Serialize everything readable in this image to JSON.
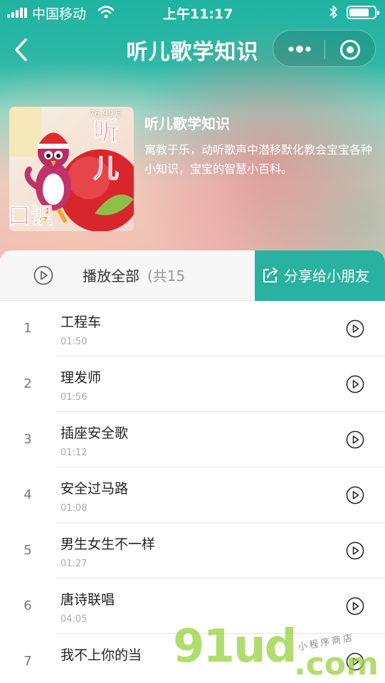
{
  "status_bar": {
    "carrier": "中国移动",
    "time": "上午11:17",
    "battery_level": 0.8
  },
  "nav": {
    "title": "听儿歌学知识"
  },
  "album": {
    "cover_text_top": "听儿",
    "cover_text_bottom": "口识",
    "plays": "76.99万",
    "title": "听儿歌学知识",
    "description": "寓教于乐，动听歌声中潜移默化教会宝宝各种小知识，宝宝的智慧小百科。"
  },
  "toolbar": {
    "play_all_label": "播放全部",
    "count_label": "(共15",
    "share_label": "分享给小朋友"
  },
  "tracks": [
    {
      "num": "1",
      "title": "工程车",
      "duration": "01:50"
    },
    {
      "num": "2",
      "title": "理发师",
      "duration": "01:56"
    },
    {
      "num": "3",
      "title": "插座安全歌",
      "duration": "01:12"
    },
    {
      "num": "4",
      "title": "安全过马路",
      "duration": "01:08"
    },
    {
      "num": "5",
      "title": "男生女生不一样",
      "duration": "01:27"
    },
    {
      "num": "6",
      "title": "唐诗联唱",
      "duration": "04:05"
    },
    {
      "num": "7",
      "title": "我不上你的当",
      "duration": ""
    }
  ],
  "watermark": {
    "main": "91ud",
    "suffix": ".com",
    "tagline": "小程序商店"
  },
  "colors": {
    "accent": "#29b2a2",
    "text": "#222222",
    "muted": "#aaaaaa"
  }
}
